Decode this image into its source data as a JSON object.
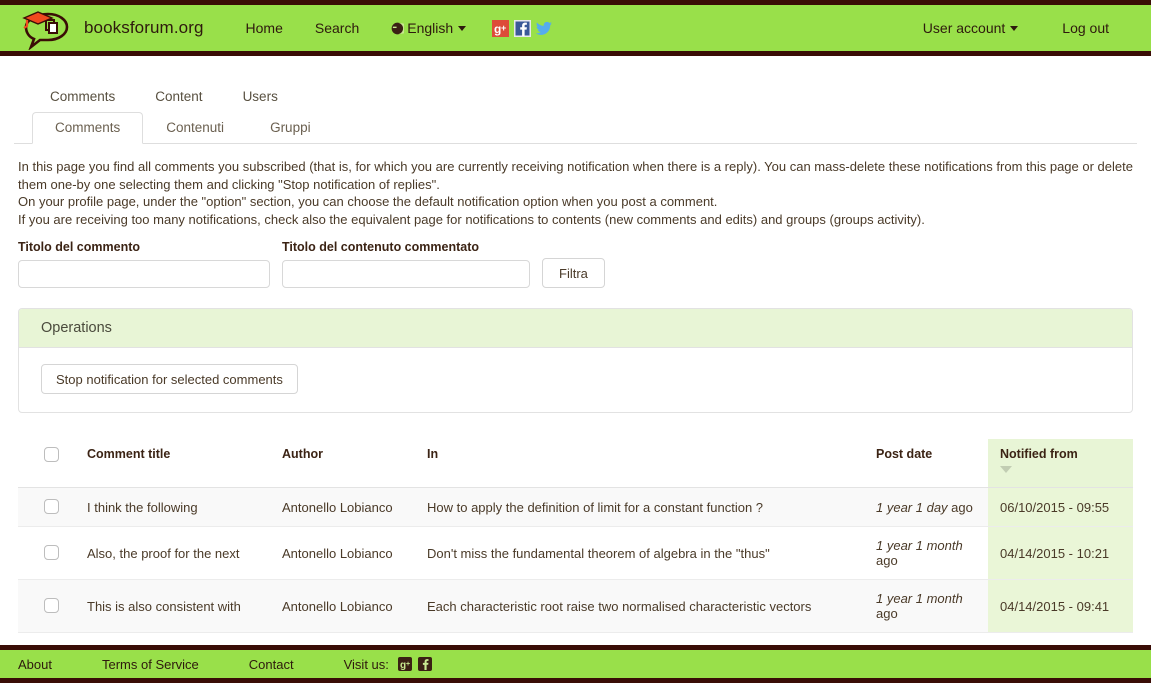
{
  "header": {
    "brand": "booksforum.org",
    "logo_icon": "speech-bubble-graduation-cap-books-logo",
    "nav": [
      {
        "label": "Home",
        "icon": null
      },
      {
        "label": "Search",
        "icon": null
      },
      {
        "label": "English",
        "icon": "globe-icon",
        "caret": true
      }
    ],
    "social": [
      {
        "name": "google-plus-icon",
        "label": "g+"
      },
      {
        "name": "facebook-icon",
        "label": "f"
      },
      {
        "name": "twitter-icon",
        "label": "bird"
      }
    ],
    "user_account": "User account",
    "log_out": "Log out"
  },
  "primary_tabs": [
    {
      "label": "Comments",
      "active": true
    },
    {
      "label": "Content",
      "active": false
    },
    {
      "label": "Users",
      "active": false
    }
  ],
  "secondary_tabs": [
    {
      "label": "Comments",
      "active": true
    },
    {
      "label": "Contenuti",
      "active": false
    },
    {
      "label": "Gruppi",
      "active": false
    }
  ],
  "description": {
    "line1": "In this page you find all comments you subscribed (that is, for which you are currently receiving notification when there is a reply). You can mass-delete these notifications from this page or delete them one-by one selecting them and clicking \"Stop notification of replies\".",
    "line2": "On your profile page, under the \"option\" section, you can choose the default notification option when you post a comment.",
    "line3": "If you are receiving too many notifications, check also the equivalent page for notifications to contents (new comments and edits) and groups (groups activity)."
  },
  "filter": {
    "comment_title_label": "Titolo del commento",
    "comment_title_value": "",
    "comment_title_placeholder": "",
    "content_title_label": "Titolo del contenuto commentato",
    "content_title_value": "",
    "content_title_placeholder": "",
    "filter_button": "Filtra"
  },
  "operations": {
    "title": "Operations",
    "stop_button": "Stop notification for selected comments"
  },
  "table": {
    "columns": [
      {
        "key": "check",
        "label": ""
      },
      {
        "key": "title",
        "label": "Comment title"
      },
      {
        "key": "author",
        "label": "Author"
      },
      {
        "key": "in",
        "label": "In"
      },
      {
        "key": "post_date",
        "label": "Post date"
      },
      {
        "key": "notified_from",
        "label": "Notified from",
        "sorted": true,
        "sort_direction": "desc"
      }
    ],
    "rows": [
      {
        "checked": false,
        "title": "I think the following",
        "author": "Antonello Lobianco",
        "in": "How to apply the definition of limit for a constant function ?",
        "post_date_relative": "1 year 1 day",
        "post_date_suffix": "ago",
        "notified_from": "06/10/2015 - 09:55"
      },
      {
        "checked": false,
        "title": "Also, the proof for the next",
        "author": "Antonello Lobianco",
        "in": "Don't miss the fundamental theorem of algebra in the \"thus\"",
        "post_date_relative": "1 year 1 month",
        "post_date_suffix": "ago",
        "notified_from": "04/14/2015 - 10:21"
      },
      {
        "checked": false,
        "title": "This is also consistent with",
        "author": "Antonello Lobianco",
        "in": "Each characteristic root raise two normalised characteristic vectors",
        "post_date_relative": "1 year 1 month",
        "post_date_suffix": "ago",
        "notified_from": "04/14/2015 - 09:41"
      }
    ]
  },
  "footer": {
    "links": [
      {
        "label": "About"
      },
      {
        "label": "Terms of Service"
      },
      {
        "label": "Contact"
      }
    ],
    "visit_label": "Visit us:",
    "social": [
      {
        "name": "google-plus-icon",
        "label": "g+"
      },
      {
        "name": "facebook-icon",
        "label": "f"
      }
    ]
  },
  "colors": {
    "brand_green": "#99e04a",
    "dark_brown": "#3a0d06",
    "panel_head_green": "#e8f5d6",
    "sorted_col_green": "#eaf6d7",
    "row_stripe": "#f9f9f9"
  }
}
